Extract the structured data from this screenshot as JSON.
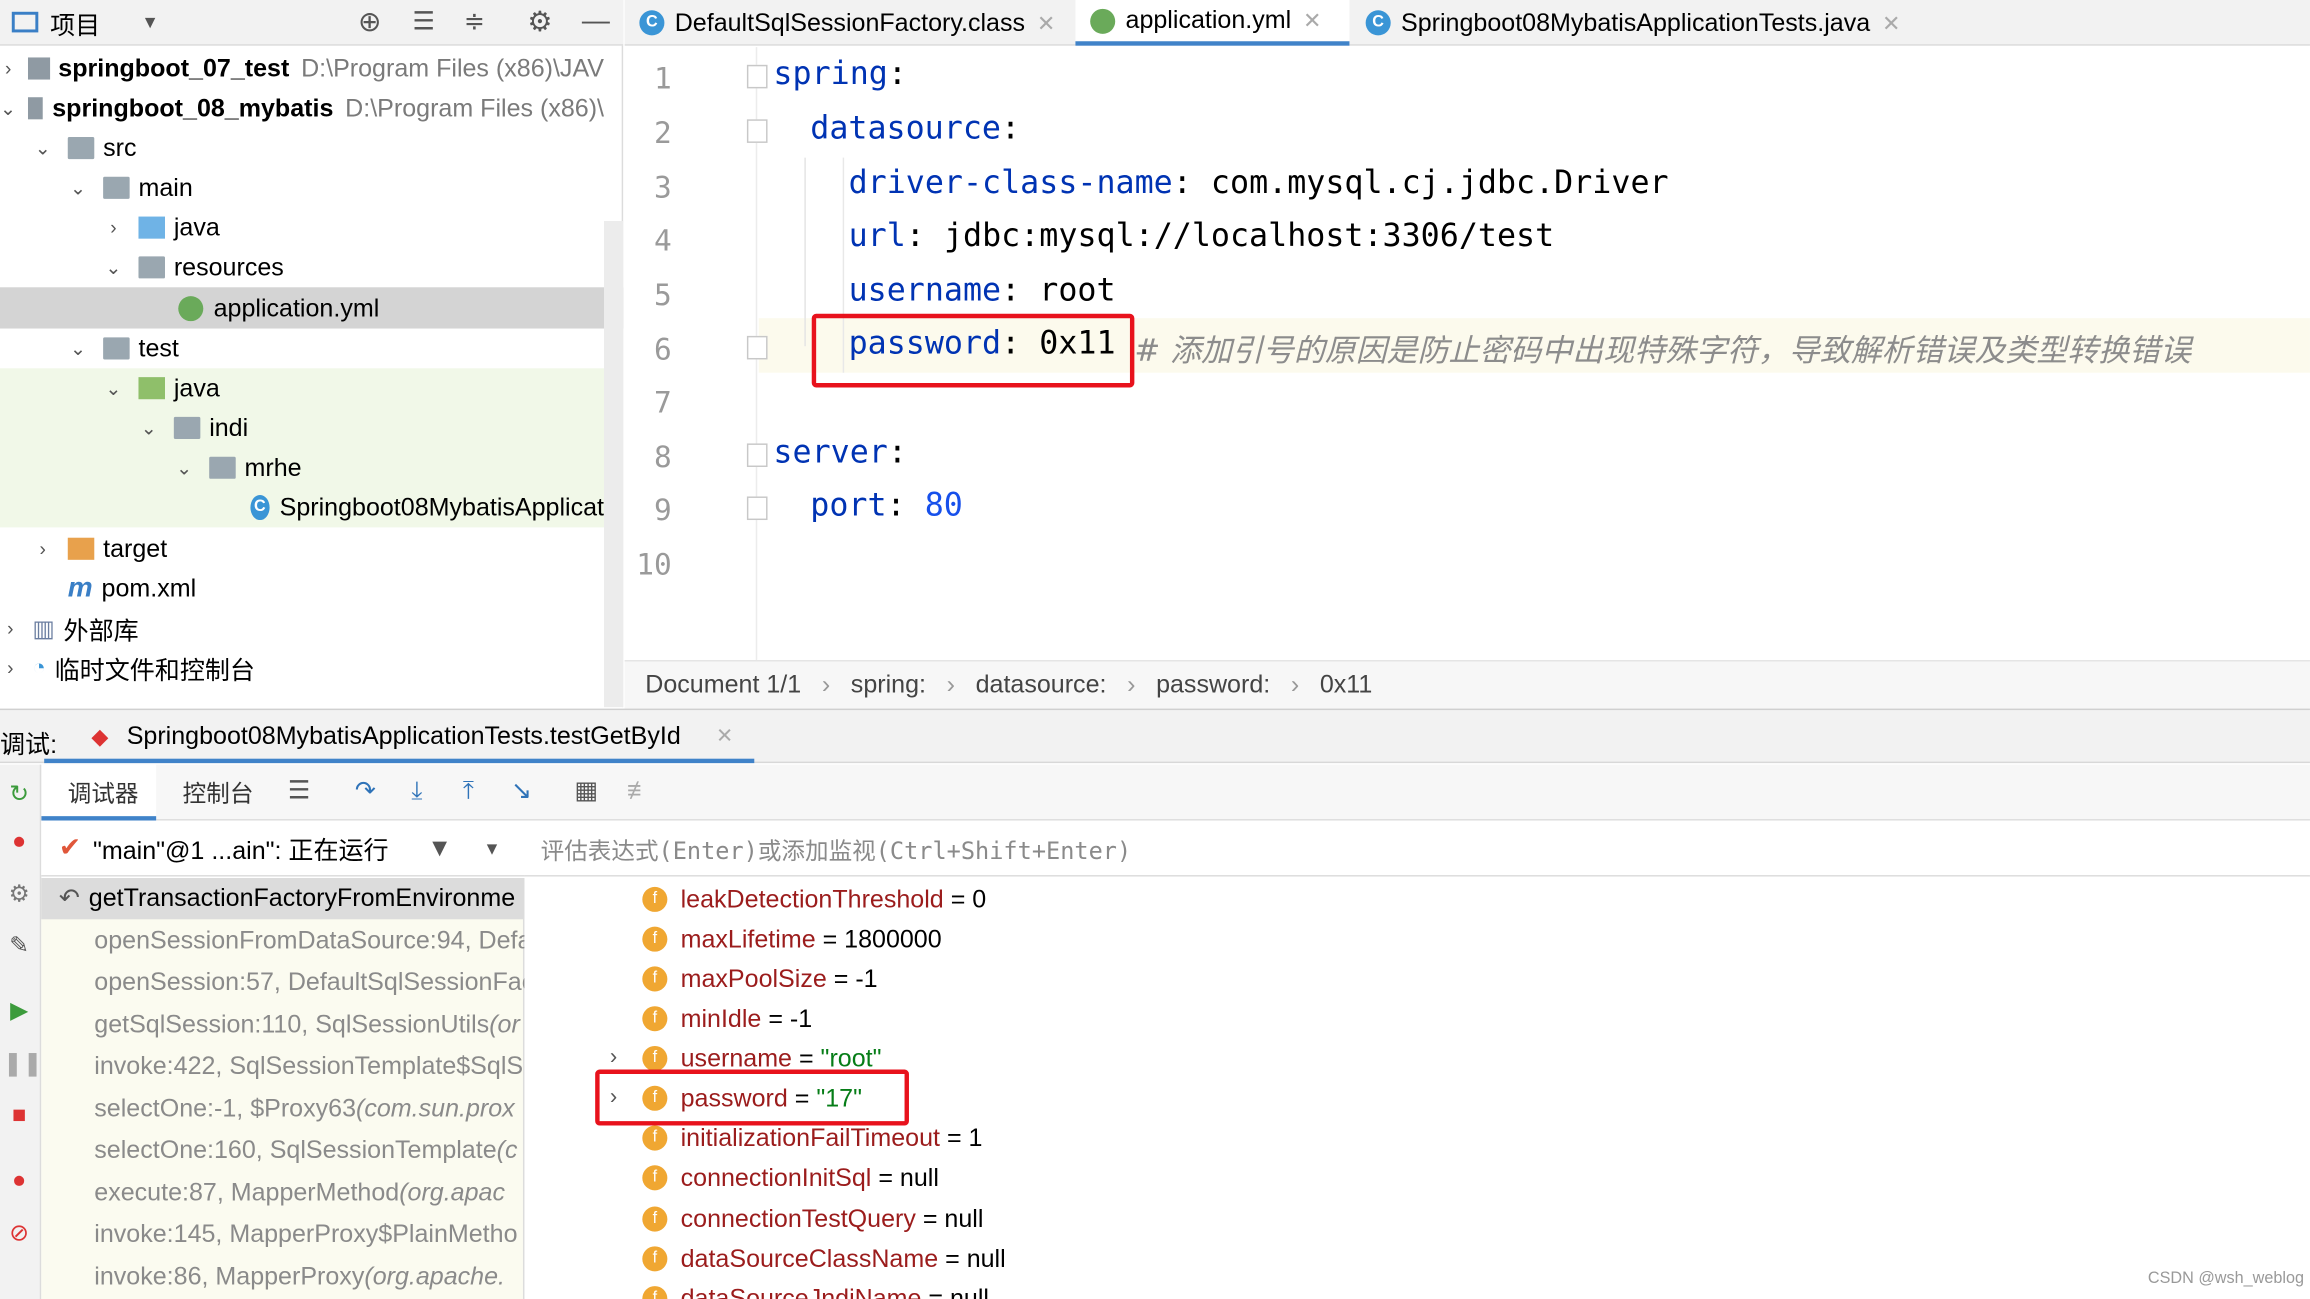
{
  "project": {
    "header_label": "项目",
    "tree": [
      {
        "label": "springboot_07_test",
        "path": "D:\\Program Files (x86)\\JAV"
      },
      {
        "label": "springboot_08_mybatis",
        "path": "D:\\Program Files (x86)\\"
      },
      {
        "label": "src"
      },
      {
        "label": "main"
      },
      {
        "label": "java"
      },
      {
        "label": "resources"
      },
      {
        "label": "application.yml"
      },
      {
        "label": "test"
      },
      {
        "label": "java"
      },
      {
        "label": "indi"
      },
      {
        "label": "mrhe"
      },
      {
        "label": "Springboot08MybatisApplicat"
      },
      {
        "label": "target"
      },
      {
        "label": "pom.xml"
      },
      {
        "label": "外部库"
      },
      {
        "label": "临时文件和控制台"
      }
    ]
  },
  "tabs": [
    {
      "label": "DefaultSqlSessionFactory.class",
      "icon": "class-icon"
    },
    {
      "label": "application.yml",
      "icon": "yaml-icon"
    },
    {
      "label": "Springboot08MybatisApplicationTests.java",
      "icon": "class-icon"
    }
  ],
  "editor": {
    "line_numbers": [
      "1",
      "2",
      "3",
      "4",
      "5",
      "6",
      "7",
      "8",
      "9",
      "10"
    ],
    "lines": {
      "l1_key": "spring",
      "l2_key": "datasource",
      "l3_key": "driver-class-name",
      "l3_val": "com.mysql.cj.jdbc.Driver",
      "l4_key": "url",
      "l4_val": "jdbc:mysql://localhost:3306/test",
      "l5_key": "username",
      "l5_val": "root",
      "l6_key": "password",
      "l6_val": "0x11",
      "l6_comment": "# 添加引号的原因是防止密码中出现特殊字符，导致解析错误及类型转换错误",
      "l8_key": "server",
      "l9_key": "port",
      "l9_val": "80"
    },
    "colon": ":"
  },
  "breadcrumbs": [
    "Document 1/1",
    "spring:",
    "datasource:",
    "password:",
    "0x11"
  ],
  "debug": {
    "label": "调试:",
    "session": "Springboot08MybatisApplicationTests.testGetById",
    "tab_debugger": "调试器",
    "tab_console": "控制台",
    "thread": "\"main\"@1 ...ain\": 正在运行",
    "eval_placeholder": "评估表达式(Enter)或添加监视(Ctrl+Shift+Enter)",
    "frames": [
      {
        "text": "getTransactionFactoryFromEnvironme",
        "pkg": ""
      },
      {
        "text": "openSessionFromDataSource:94, Defa",
        "pkg": ""
      },
      {
        "text": "openSession:57, DefaultSqlSessionFac",
        "pkg": ""
      },
      {
        "text": "getSqlSession:110, SqlSessionUtils ",
        "pkg": "(or"
      },
      {
        "text": "invoke:422, SqlSessionTemplate$SqlS",
        "pkg": ""
      },
      {
        "text": "selectOne:-1, $Proxy63 ",
        "pkg": "(com.sun.prox"
      },
      {
        "text": "selectOne:160, SqlSessionTemplate ",
        "pkg": "(c"
      },
      {
        "text": "execute:87, MapperMethod ",
        "pkg": "(org.apac"
      },
      {
        "text": "invoke:145, MapperProxy$PlainMetho",
        "pkg": ""
      },
      {
        "text": "invoke:86, MapperProxy ",
        "pkg": "(org.apache."
      }
    ],
    "variables": [
      {
        "name": "leakDetectionThreshold",
        "eq": " = ",
        "value": "0",
        "type": "num"
      },
      {
        "name": "maxLifetime",
        "eq": " = ",
        "value": "1800000",
        "type": "num"
      },
      {
        "name": "maxPoolSize",
        "eq": " = ",
        "value": "-1",
        "type": "num"
      },
      {
        "name": "minIdle",
        "eq": " = ",
        "value": "-1",
        "type": "num"
      },
      {
        "name": "username",
        "eq": " = ",
        "value": "\"root\"",
        "type": "str"
      },
      {
        "name": "password",
        "eq": " = ",
        "value": "\"17\"",
        "type": "str"
      },
      {
        "name": "initializationFailTimeout",
        "eq": " = ",
        "value": "1",
        "type": "num"
      },
      {
        "name": "connectionInitSql",
        "eq": " = ",
        "value": "null",
        "type": "num"
      },
      {
        "name": "connectionTestQuery",
        "eq": " = ",
        "value": "null",
        "type": "num"
      },
      {
        "name": "dataSourceClassName",
        "eq": " = ",
        "value": "null",
        "type": "num"
      },
      {
        "name": "dataSourceJndiName",
        "eq": " = ",
        "value": "null",
        "type": "num"
      }
    ]
  },
  "watermark": "CSDN @wsh_weblog",
  "colors": {
    "highlight": "#e8121c",
    "keyword": "#0033b3",
    "string": "#067d17"
  }
}
